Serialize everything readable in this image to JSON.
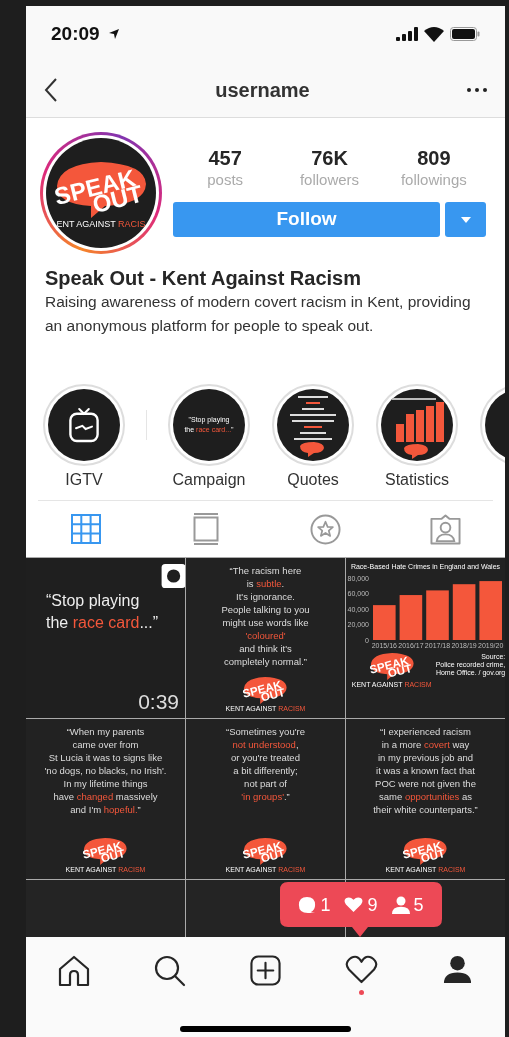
{
  "status_bar": {
    "time": "20:09"
  },
  "nav": {
    "title": "username"
  },
  "profile": {
    "avatar_logo": {
      "top": "SPEAK",
      "bottom": "OUT",
      "tagline": "ENT AGAINST",
      "tagline_accent": "RACIS"
    },
    "stats": [
      {
        "value": "457",
        "label": "posts"
      },
      {
        "value": "76K",
        "label": "followers"
      },
      {
        "value": "809",
        "label": "followings"
      }
    ],
    "follow_button": "Follow",
    "name": "Speak Out - Kent Against Racism",
    "bio": "Raising awareness of modern covert racism in Kent, providing an anonymous platform for people to speak out."
  },
  "highlights": [
    {
      "kind": "igtv",
      "label": "IGTV"
    },
    {
      "kind": "quote",
      "label": "Campaign",
      "lines": [
        [
          {
            "t": "\"Stop playing",
            "accent": false
          }
        ],
        [
          {
            "t": "the ",
            "accent": false
          },
          {
            "t": "race card...",
            "accent": true
          },
          {
            "t": "\"",
            "accent": false
          }
        ]
      ]
    },
    {
      "kind": "quote-picture",
      "label": "Quotes"
    },
    {
      "kind": "chart-picture",
      "label": "Statistics"
    },
    {
      "kind": "partial"
    }
  ],
  "tabs": [
    {
      "kind": "grid",
      "selected": true
    },
    {
      "kind": "feed",
      "selected": false
    },
    {
      "kind": "star",
      "selected": false
    },
    {
      "kind": "tagged",
      "selected": false
    }
  ],
  "posts": [
    {
      "kind": "video",
      "duration": "0:39",
      "lines": [
        [
          {
            "t": "“Stop playing",
            "accent": false
          }
        ],
        [
          {
            "t": "the ",
            "accent": false
          },
          {
            "t": "race card",
            "accent": true
          },
          {
            "t": "...”",
            "accent": false
          }
        ]
      ]
    },
    {
      "kind": "quote",
      "lines": [
        [
          {
            "t": "“The racism here",
            "accent": false
          }
        ],
        [
          {
            "t": "is ",
            "accent": false
          },
          {
            "t": "subtle",
            "accent": true
          },
          {
            "t": "."
          }
        ],
        [
          {
            "t": "It's ignorance.",
            "accent": false
          }
        ],
        [
          {
            "t": "People talking to you",
            "accent": false
          }
        ],
        [
          {
            "t": "might use words like",
            "accent": false
          }
        ],
        [
          {
            "t": "'coloured'",
            "accent": true
          }
        ],
        [
          {
            "t": "and think it's",
            "accent": false
          }
        ],
        [
          {
            "t": "completely normal.”",
            "accent": false
          }
        ]
      ],
      "logo": {
        "top": "SPEAK",
        "bottom": "OUT",
        "tagline": "KENT AGAINST",
        "tagline_accent": "RACISM"
      }
    },
    {
      "kind": "chart",
      "chart_data": {
        "type": "bar",
        "title": "Race-Based Hate Crimes in England and Wales",
        "categories": [
          "2015/16",
          "2016/17",
          "2017/18",
          "2018/19",
          "2019/20"
        ],
        "values": [
          45000,
          58000,
          64000,
          72000,
          76000
        ],
        "ylim": [
          0,
          80000
        ],
        "yticks": [
          {
            "value": 0,
            "label": "0"
          },
          {
            "value": 20000,
            "label": "20,000"
          },
          {
            "value": 40000,
            "label": "40,000"
          },
          {
            "value": 60000,
            "label": "60,000"
          },
          {
            "value": 80000,
            "label": "80,000"
          }
        ]
      },
      "source": [
        "Source:",
        "Police recorded crime,",
        "Home Office. / gov.org"
      ],
      "logo": {
        "top": "SPEAK",
        "bottom": "OUT",
        "tagline": "KENT AGAINST",
        "tagline_accent": "RACISM"
      }
    },
    {
      "kind": "quote",
      "lines": [
        [
          {
            "t": "“When my parents",
            "accent": false
          }
        ],
        [
          {
            "t": "came over from",
            "accent": false
          }
        ],
        [
          {
            "t": "St Lucia it was to signs like",
            "accent": false
          }
        ],
        [
          {
            "t": "'no dogs, no blacks, no Irish'.",
            "accent": false
          }
        ],
        [
          {
            "t": "In my lifetime things",
            "accent": false
          }
        ],
        [
          {
            "t": "have ",
            "accent": false
          },
          {
            "t": "changed",
            "accent": true
          },
          {
            "t": " massively",
            "accent": false
          }
        ],
        [
          {
            "t": "and I'm ",
            "accent": false
          },
          {
            "t": "hopeful.",
            "accent": true
          },
          {
            "t": "”",
            "accent": false
          }
        ]
      ],
      "logo": {
        "top": "SPEAK",
        "bottom": "OUT",
        "tagline": "KENT AGAINST",
        "tagline_accent": "RACISM"
      }
    },
    {
      "kind": "quote",
      "lines": [
        [
          {
            "t": "“Sometimes you're",
            "accent": false
          }
        ],
        [
          {
            "t": "not understood",
            "accent": true
          },
          {
            "t": ",",
            "accent": false
          }
        ],
        [
          {
            "t": "or you're treated",
            "accent": false
          }
        ],
        [
          {
            "t": "a bit differently;",
            "accent": false
          }
        ],
        [
          {
            "t": "not part of",
            "accent": false
          }
        ],
        [
          {
            "t": "'in groups'",
            "accent": true
          },
          {
            "t": ".”",
            "accent": false
          }
        ]
      ],
      "logo": {
        "top": "SPEAK",
        "bottom": "OUT",
        "tagline": "KENT AGAINST",
        "tagline_accent": "RACISM"
      }
    },
    {
      "kind": "quote",
      "lines": [
        [
          {
            "t": "“I experienced racism",
            "accent": false
          }
        ],
        [
          {
            "t": "in a more ",
            "accent": false
          },
          {
            "t": "covert",
            "accent": true
          },
          {
            "t": " way",
            "accent": false
          }
        ],
        [
          {
            "t": "in my previous job and",
            "accent": false
          }
        ],
        [
          {
            "t": "it was a known fact that",
            "accent": false
          }
        ],
        [
          {
            "t": "POC were not given the",
            "accent": false
          }
        ],
        [
          {
            "t": "same ",
            "accent": false
          },
          {
            "t": "opportunities",
            "accent": true
          },
          {
            "t": " as",
            "accent": false
          }
        ],
        [
          {
            "t": "their white counterparts.”",
            "accent": false
          }
        ]
      ],
      "logo": {
        "top": "SPEAK",
        "bottom": "OUT",
        "tagline": "KENT AGAINST",
        "tagline_accent": "RACISM"
      }
    },
    {
      "kind": "empty"
    },
    {
      "kind": "empty"
    },
    {
      "kind": "empty"
    }
  ],
  "notification": [
    {
      "kind": "comments",
      "count": "1"
    },
    {
      "kind": "likes",
      "count": "9"
    },
    {
      "kind": "followers",
      "count": "5"
    }
  ],
  "bottom_nav": [
    {
      "kind": "home",
      "badge": false
    },
    {
      "kind": "search",
      "badge": false
    },
    {
      "kind": "add",
      "badge": false
    },
    {
      "kind": "activity",
      "badge": true
    },
    {
      "kind": "profile",
      "badge": false
    }
  ]
}
